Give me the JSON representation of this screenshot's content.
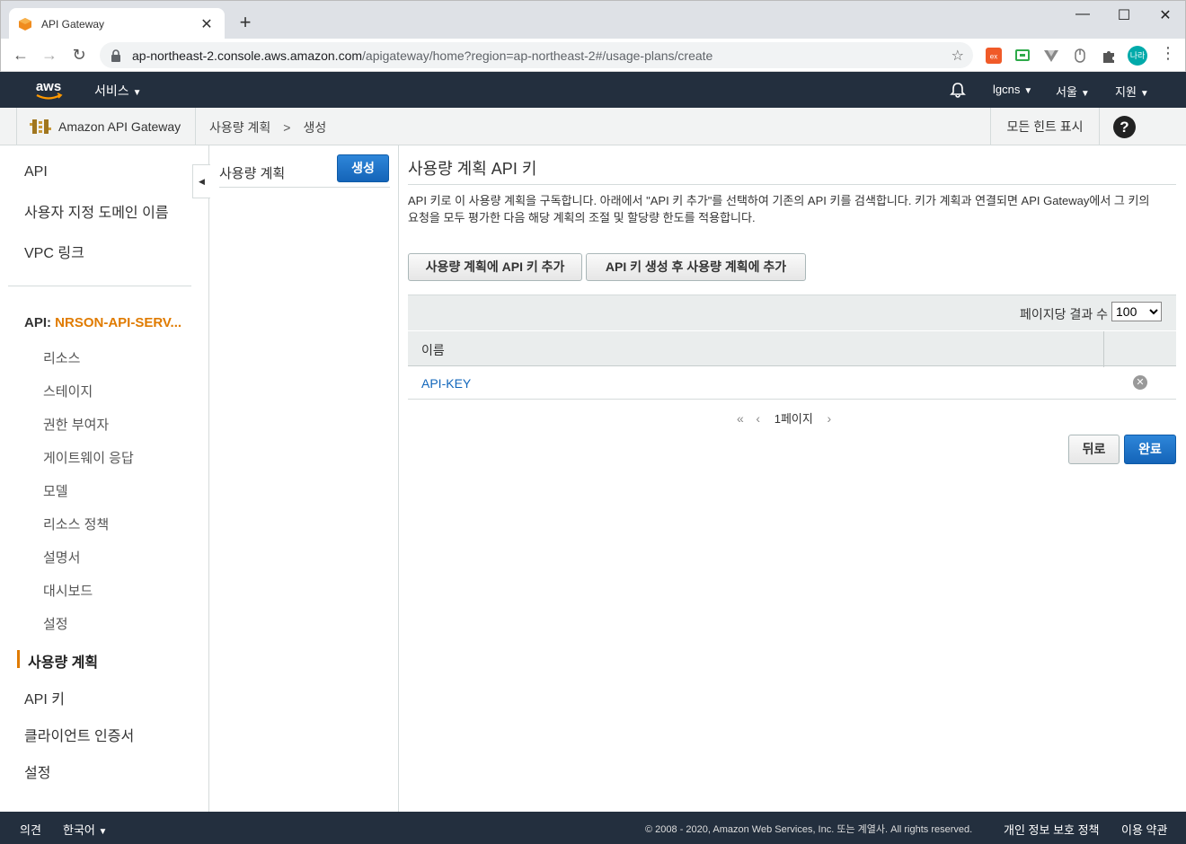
{
  "browser": {
    "tab_title": "API Gateway",
    "url_host": "ap-northeast-2.console.aws.amazon.com",
    "url_path": "/apigateway/home?region=ap-northeast-2#/usage-plans/create",
    "profile_label": "나라"
  },
  "aws_header": {
    "services_label": "서비스",
    "account_label": "lgcns",
    "region_label": "서울",
    "support_label": "지원"
  },
  "service_bar": {
    "service_name": "Amazon API Gateway",
    "breadcrumb_parent": "사용량 계획",
    "breadcrumb_sep": ">",
    "breadcrumb_current": "생성",
    "hints_label": "모든 힌트 표시",
    "help_label": "?"
  },
  "left_nav": {
    "top_items": [
      "API",
      "사용자 지정 도메인 이름",
      "VPC 링크"
    ],
    "api_prefix": "API:",
    "api_name": "NRSON-API-SERV...",
    "api_items": [
      "리소스",
      "스테이지",
      "권한 부여자",
      "게이트웨이 응답",
      "모델",
      "리소스 정책",
      "설명서",
      "대시보드",
      "설정"
    ],
    "bottom_items": [
      "사용량 계획",
      "API 키",
      "클라이언트 인증서",
      "설정"
    ],
    "active_item": "사용량 계획"
  },
  "mid_column": {
    "heading": "사용량 계획",
    "create_label": "생성"
  },
  "main": {
    "title": "사용량 계획 API 키",
    "description": "API 키로 이 사용량 계획을 구독합니다. 아래에서 \"API 키 추가\"를 선택하여 기존의 API 키를 검색합니다. 키가 계획과 연결되면 API Gateway에서 그 키의 요청을 모두 평가한 다음 해당 계획의 조절 및 할당량 한도를 적용합니다.",
    "add_key_label": "사용량 계획에 API 키 추가",
    "create_key_label": "API 키 생성 후 사용량 계획에 추가",
    "per_page_label": "페이지당 결과 수",
    "per_page_value": "100",
    "column_name": "이름",
    "rows": [
      {
        "name": "API-KEY"
      }
    ],
    "page_label": "1페이지",
    "back_label": "뒤로",
    "done_label": "완료"
  },
  "footer": {
    "feedback_label": "의견",
    "language_label": "한국어",
    "copyright": "© 2008 - 2020, Amazon Web Services, Inc. 또는 계열사. All rights reserved.",
    "privacy_label": "개인 정보 보호 정책",
    "terms_label": "이용 약관"
  },
  "colors": {
    "aws_dark": "#232f3e",
    "accent_orange": "#e07b00",
    "primary_blue": "#1464b8",
    "link_blue": "#1166bb"
  }
}
